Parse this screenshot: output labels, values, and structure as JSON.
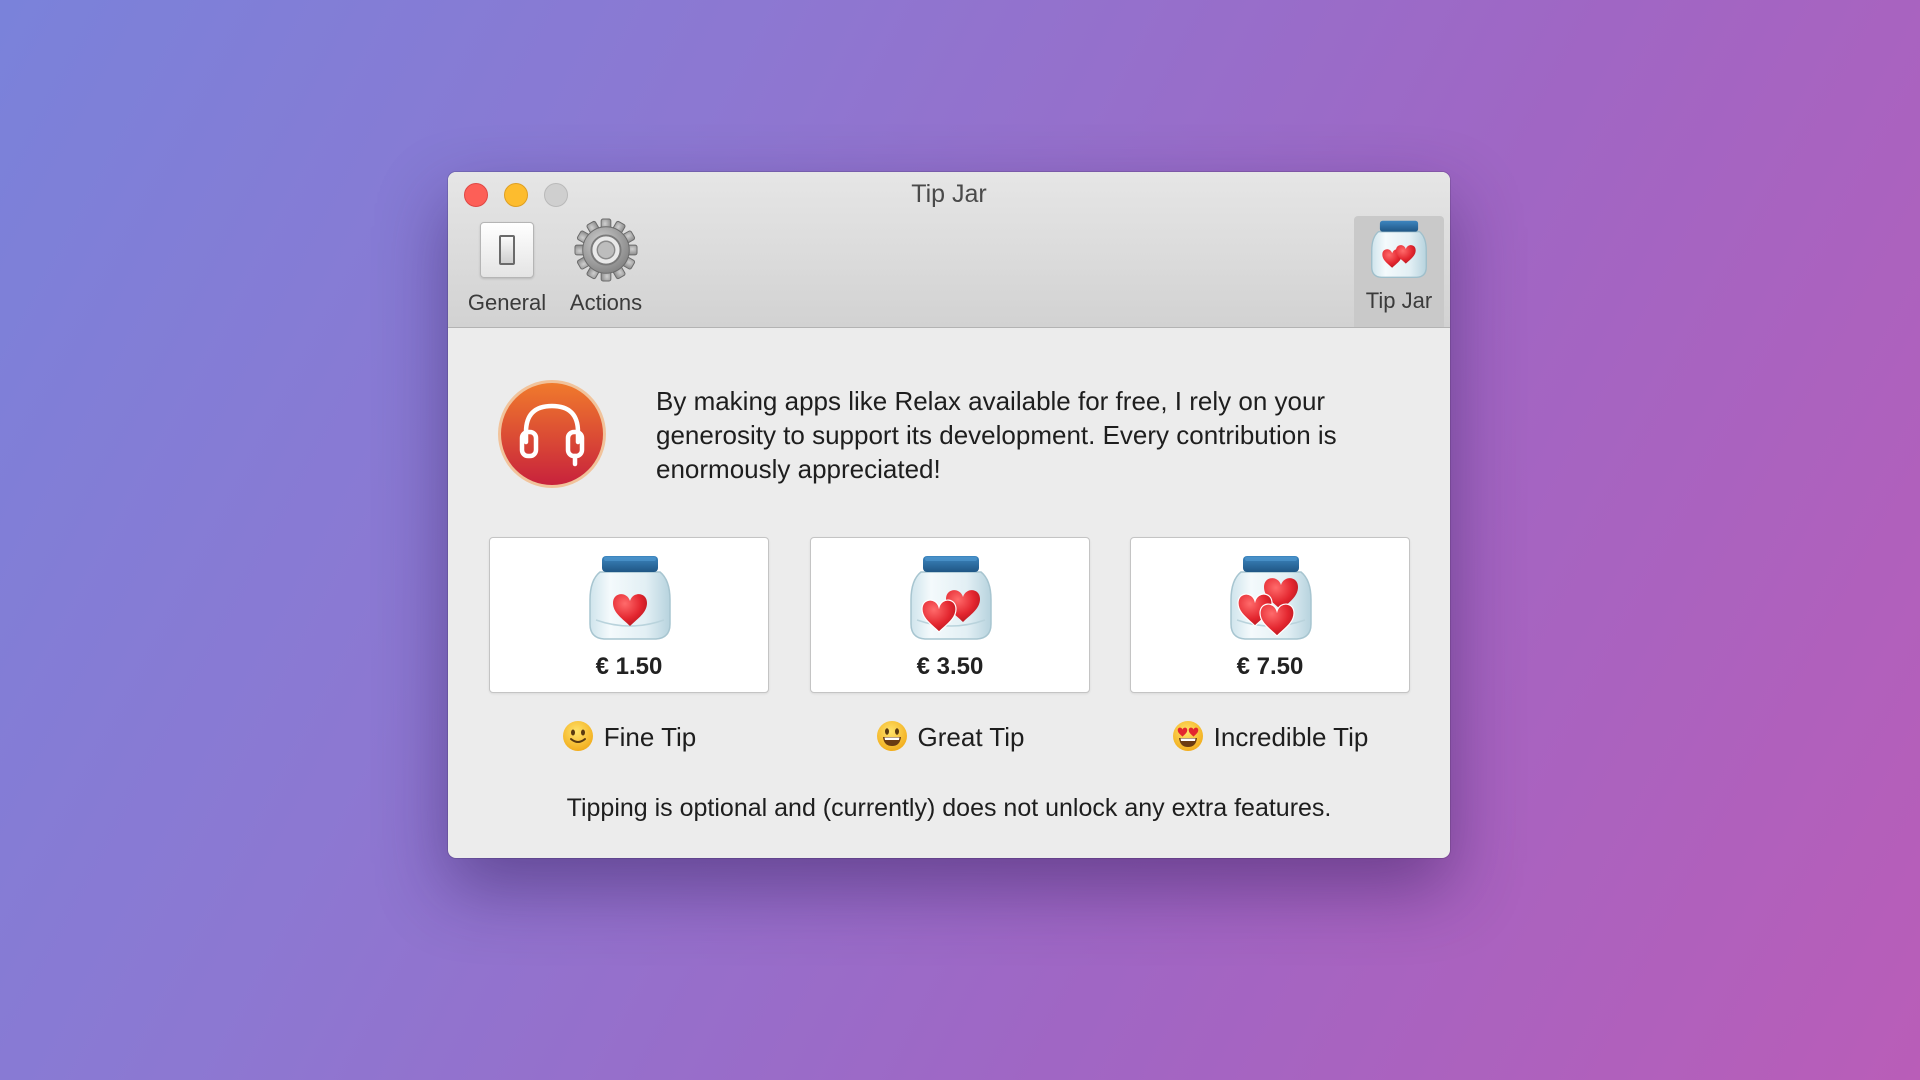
{
  "window": {
    "title": "Tip Jar"
  },
  "toolbar": {
    "items": [
      {
        "label": "General",
        "icon": "switch-icon",
        "selected": false
      },
      {
        "label": "Actions",
        "icon": "gear-icon",
        "selected": false
      },
      {
        "label": "Tip Jar",
        "icon": "tip-jar-icon",
        "selected": true
      }
    ]
  },
  "main": {
    "app_icon": "headphones-icon",
    "intro": "By making apps like Relax available for free, I rely on your generosity to support its development. Every contribution is enormously appreciated!",
    "tips": [
      {
        "price": "€ 1.50",
        "label": "Fine Tip",
        "emoji": "slightly-smiling-face-icon",
        "hearts": 1
      },
      {
        "price": "€ 3.50",
        "label": "Great Tip",
        "emoji": "grinning-face-icon",
        "hearts": 2
      },
      {
        "price": "€ 7.50",
        "label": "Incredible Tip",
        "emoji": "heart-eyes-face-icon",
        "hearts": 3
      }
    ],
    "footer": "Tipping is optional and (currently) does not unlock any extra features."
  },
  "colors": {
    "close": "#fd5f57",
    "minimize": "#fdbc2e",
    "zoom_disabled": "#cfcfcf",
    "heart": "#e3262f",
    "jar_lid": "#2b6ea6",
    "app_icon_gradient": [
      "#f07a2c",
      "#c8223c"
    ]
  }
}
